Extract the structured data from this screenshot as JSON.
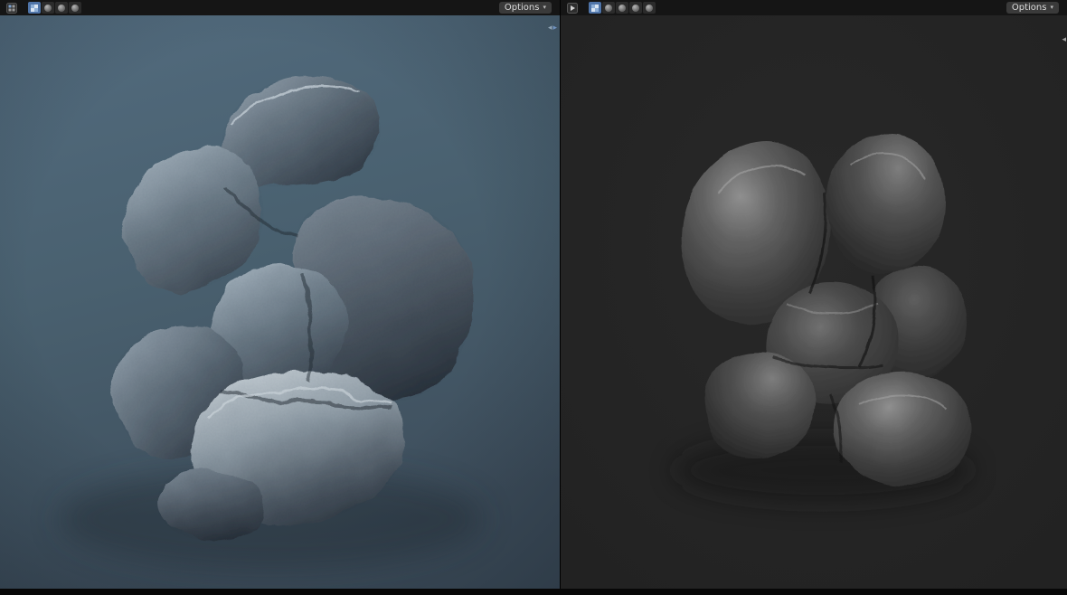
{
  "window": {
    "title": "3D Viewport Split View"
  },
  "accent_color": "#4772b3",
  "icons": {
    "caret_down": "▾",
    "splitter_left": "◂",
    "splitter_right": "▸",
    "sidebar_collapse": "◂"
  },
  "left_viewport": {
    "options_label": "Options",
    "shading_mode": "rendered",
    "toolbar_buttons": [
      {
        "name": "overlay-checker",
        "selected": true
      },
      {
        "name": "shading-sphere-1",
        "selected": false
      },
      {
        "name": "shading-sphere-2",
        "selected": false
      },
      {
        "name": "shading-sphere-3",
        "selected": false
      }
    ],
    "colors": {
      "bg_top": "#536c7f",
      "bg_bottom": "#3e4e5c",
      "rock_highlight": "#a3b1bc",
      "rock_shadow": "#2e3843"
    }
  },
  "right_viewport": {
    "options_label": "Options",
    "shading_mode": "solid",
    "toolbar_buttons": [
      {
        "name": "overlay-checker",
        "selected": true
      },
      {
        "name": "shading-sphere-1",
        "selected": false
      },
      {
        "name": "shading-sphere-2",
        "selected": false
      },
      {
        "name": "shading-sphere-3",
        "selected": false
      },
      {
        "name": "shading-sphere-4",
        "selected": false
      }
    ],
    "colors": {
      "bg": "#242424",
      "rock_base": "#3f3f3f",
      "rock_highlight": "#8f8f8f"
    }
  }
}
